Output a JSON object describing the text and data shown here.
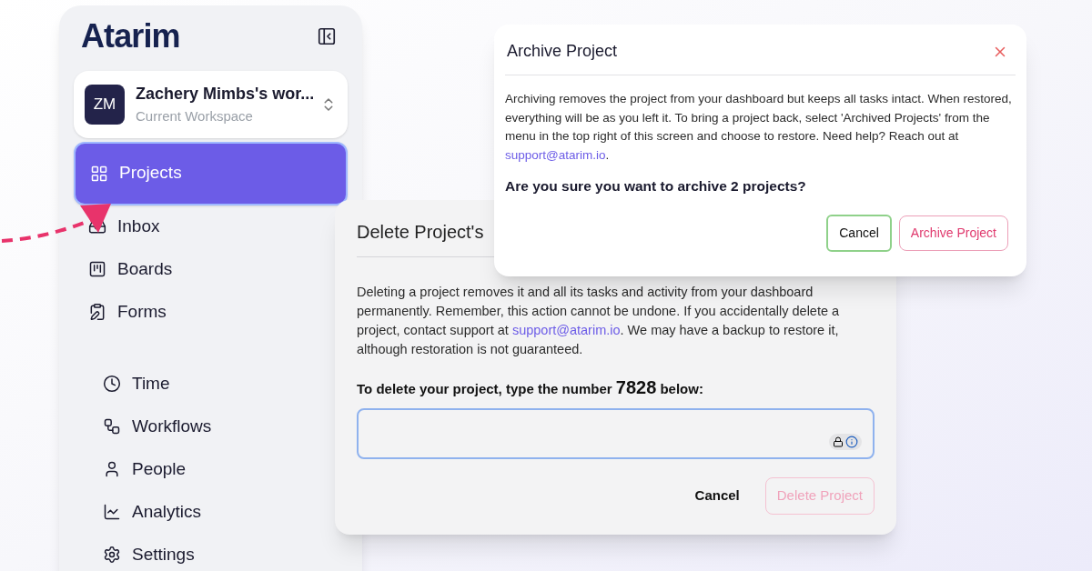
{
  "sidebar": {
    "logo": "Atarim",
    "workspace": {
      "initials": "ZM",
      "name": "Zachery Mimbs's wor...",
      "subtitle": "Current Workspace"
    },
    "nav": [
      {
        "kind": "projects",
        "label": "Projects",
        "selected": true
      },
      {
        "kind": "inbox",
        "label": "Inbox",
        "selected": false
      },
      {
        "kind": "boards",
        "label": "Boards",
        "selected": false
      },
      {
        "kind": "forms",
        "label": "Forms",
        "selected": false
      }
    ],
    "nav_secondary": [
      {
        "kind": "time",
        "label": "Time",
        "selected": false
      },
      {
        "kind": "workflows",
        "label": "Workflows",
        "selected": false
      },
      {
        "kind": "people",
        "label": "People",
        "selected": false
      },
      {
        "kind": "analytics",
        "label": "Analytics",
        "selected": false
      },
      {
        "kind": "settings",
        "label": "Settings",
        "selected": false
      }
    ]
  },
  "delete_dialog": {
    "title": "Delete Project's",
    "body_before": "Deleting a project removes it and all its tasks and activity from your dashboard permanently. Remember, this action cannot be undone. If you accidentally delete a project, contact support at ",
    "link": "support@atarim.io",
    "body_after": ". We may have a backup to restore it, although restoration is not guaranteed.",
    "prompt": "To delete your project, type the number **7828** below:",
    "cancel": "Cancel",
    "confirm": {
      "label": "Delete Project",
      "disabled": true
    }
  },
  "archive_dialog": {
    "title": "Archive Project",
    "body_before": "Archiving removes the project from your dashboard but keeps all tasks intact. When restored, everything will be as you left it. To bring a project back, select 'Archived Projects' from the menu in the top right of this screen and choose to restore. Need help? Reach out at ",
    "link": "support@atarim.io",
    "body_after": ".",
    "question": "Are you sure you want to archive 2 projects?",
    "cancel": "Cancel",
    "confirm": {
      "label": "Archive Project",
      "disabled": false
    }
  }
}
